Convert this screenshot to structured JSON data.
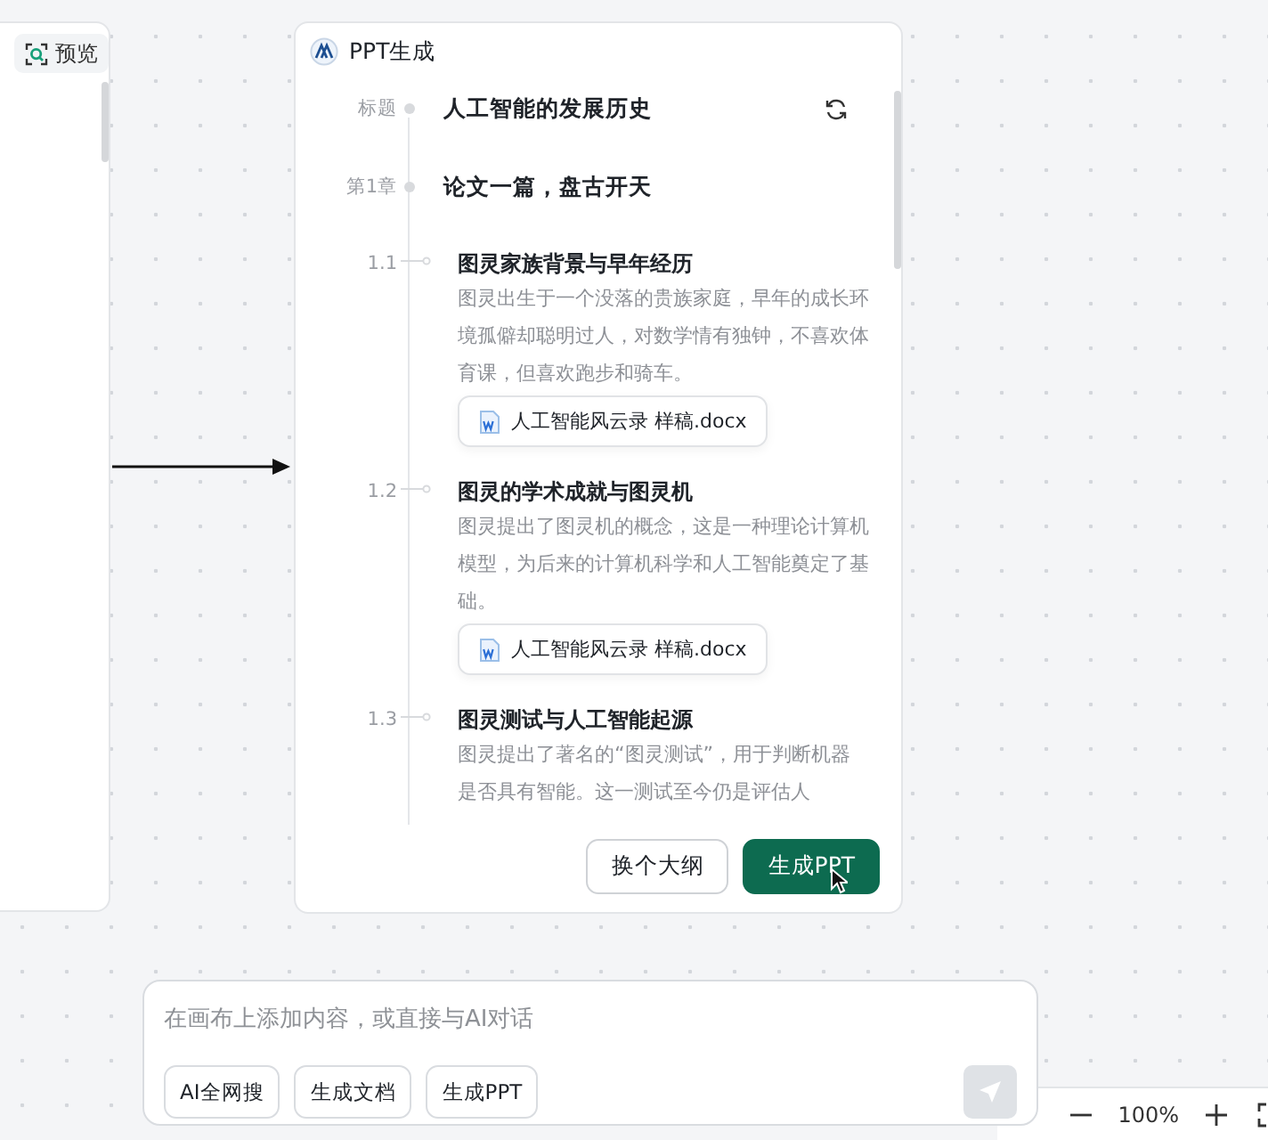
{
  "preview_tab": {
    "label": "预览"
  },
  "card": {
    "title": "PPT生成",
    "outline": {
      "title_label": "标题",
      "title": "人工智能的发展历史",
      "chapters": [
        {
          "label": "第1章",
          "title": "论文一篇，盘古开天",
          "sections": [
            {
              "number": "1.1",
              "title": "图灵家族背景与早年经历",
              "description": "图灵出生于一个没落的贵族家庭，早年的成长环境孤僻却聪明过人，对数学情有独钟，不喜欢体育课，但喜欢跑步和骑车。",
              "attachment": "人工智能风云录 样稿.docx"
            },
            {
              "number": "1.2",
              "title": "图灵的学术成就与图灵机",
              "description": "图灵提出了图灵机的概念，这是一种理论计算机模型，为后来的计算机科学和人工智能奠定了基础。",
              "attachment": "人工智能风云录 样稿.docx"
            },
            {
              "number": "1.3",
              "title": "图灵测试与人工智能起源",
              "description": "图灵提出了著名的“图灵测试”，用于判断机器是否具有智能。这一测试至今仍是评估人"
            }
          ]
        }
      ]
    },
    "buttons": [
      {
        "label": "换个大纲",
        "kind": "secondary"
      },
      {
        "label": "生成PPT",
        "kind": "primary"
      }
    ]
  },
  "chat": {
    "placeholder": "在画布上添加内容，或直接与AI对话",
    "actions": [
      "AI全网搜",
      "生成文档",
      "生成PPT"
    ]
  },
  "zoom": {
    "level_text": "100%"
  }
}
